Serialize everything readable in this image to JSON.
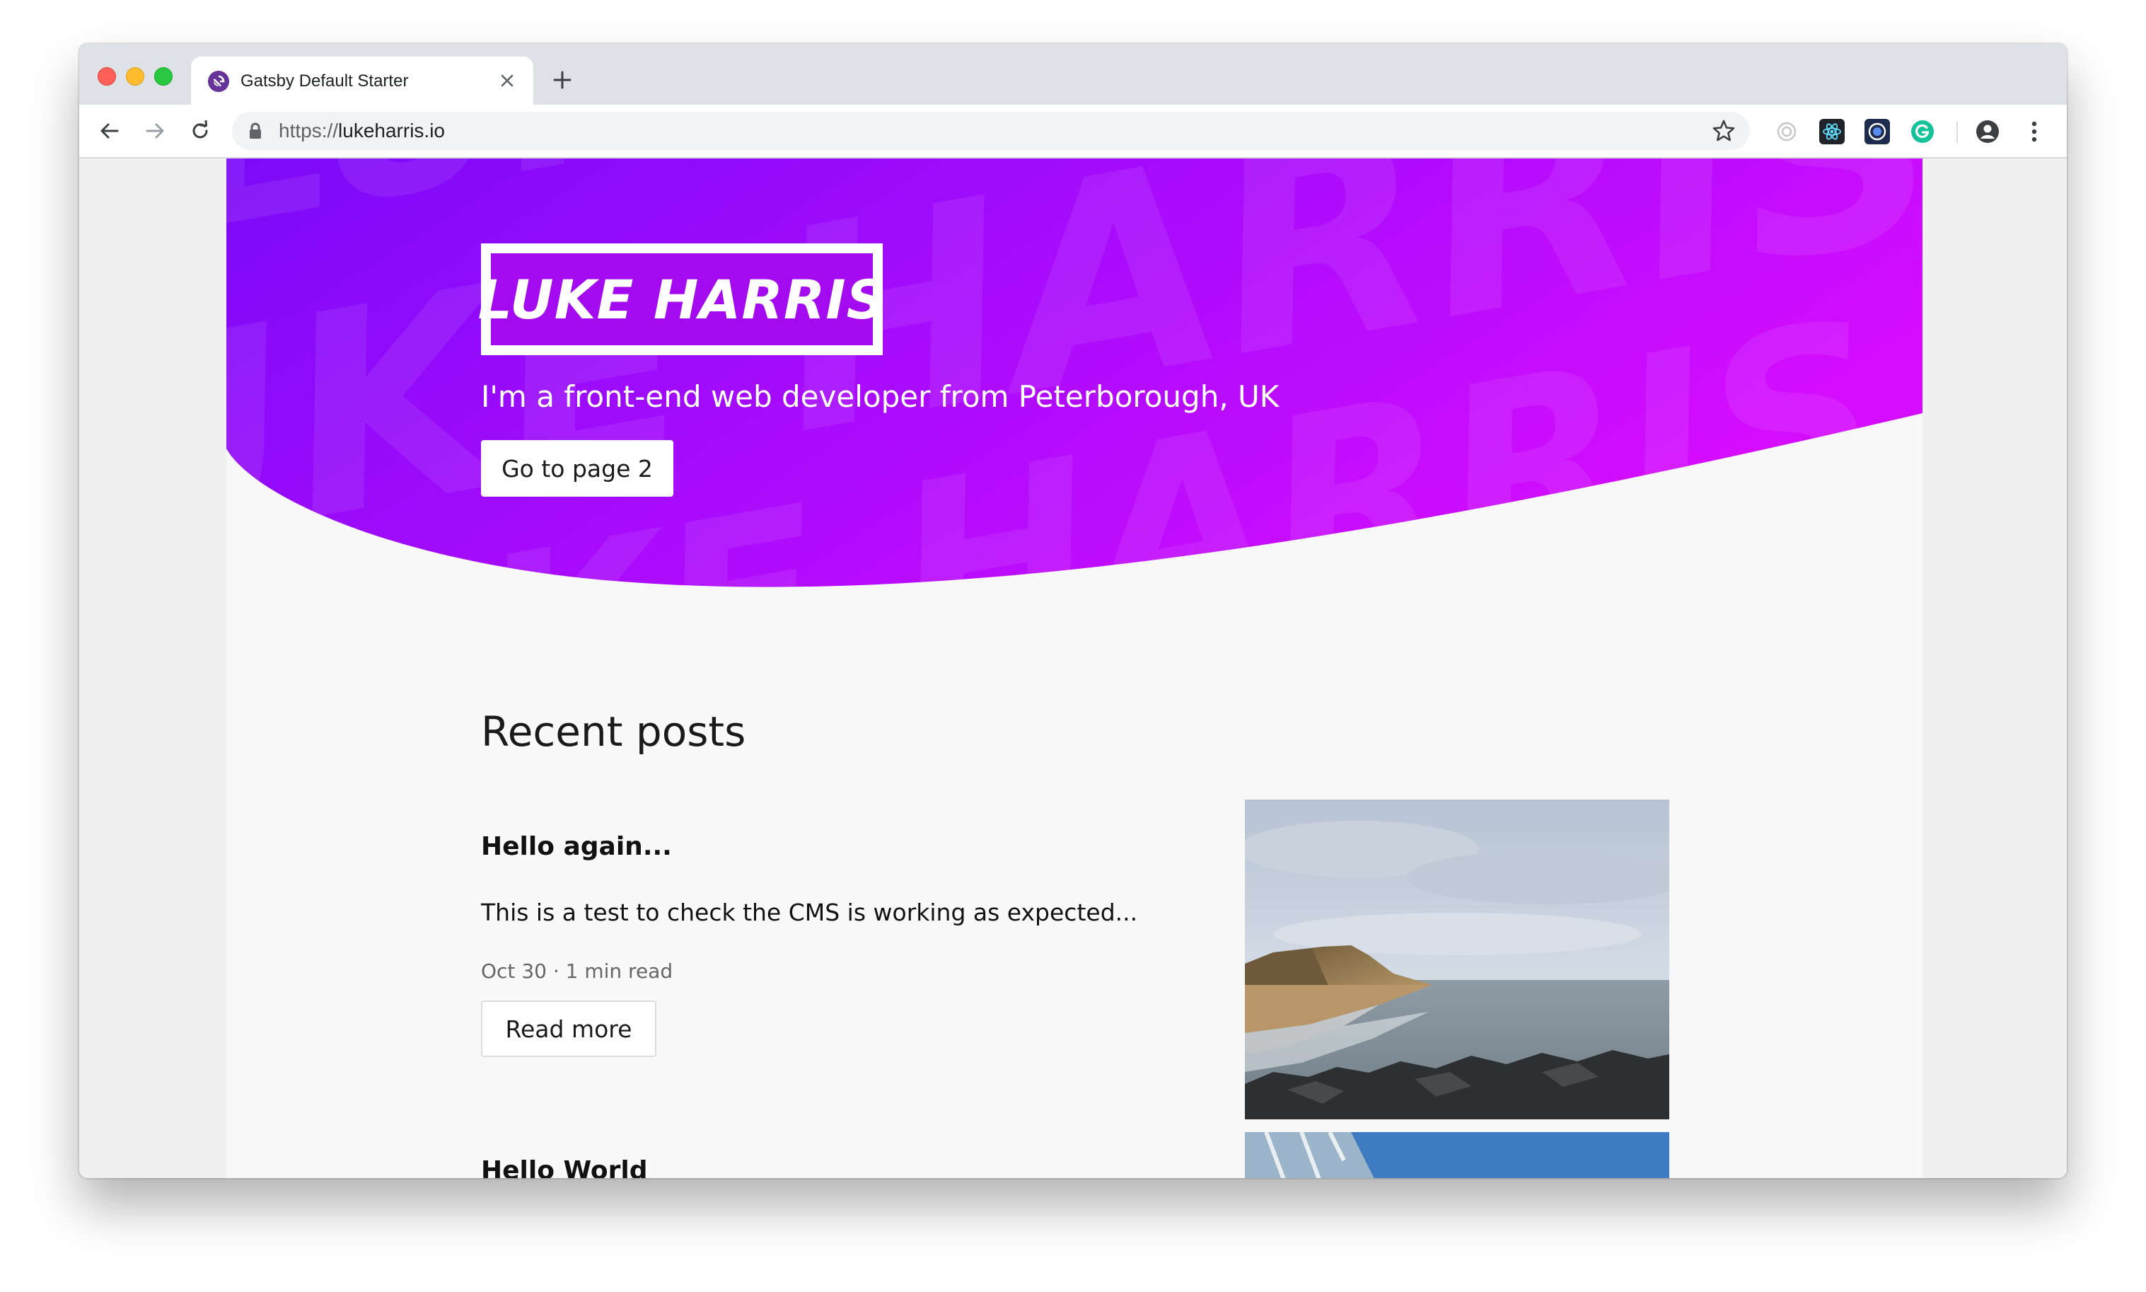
{
  "browser": {
    "tab_title": "Gatsby Default Starter",
    "url_scheme": "https://",
    "url_host": "lukeharris.io"
  },
  "hero": {
    "logo_text": "LUKE HARRIS",
    "tagline": "I'm a front-end web developer from Peterborough, UK",
    "button_label": "Go to page 2",
    "background_words": "LUKE HARRIS",
    "gradient_start": "#7b0af8",
    "gradient_end": "#d40cff"
  },
  "posts_section": {
    "title": "Recent posts",
    "posts": [
      {
        "title": "Hello again...",
        "excerpt": "This is a test to check the CMS is working as expected...",
        "meta": "Oct 30 · 1 min read",
        "button_label": "Read more",
        "image": "coastal-cliff-beach-photo"
      },
      {
        "title": "Hello World",
        "image": "glass-building-photo"
      }
    ]
  }
}
